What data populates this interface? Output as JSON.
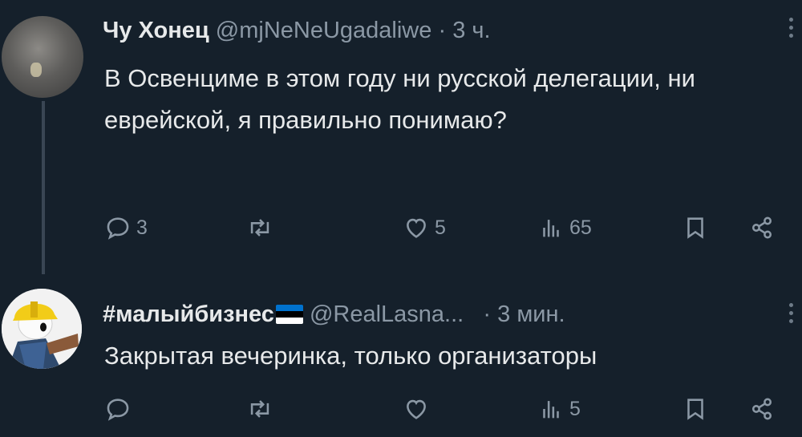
{
  "tweets": [
    {
      "name": "Чу Хонец",
      "handle": "@mjNeNeUgadaliwe",
      "separator": "·",
      "time": "3 ч.",
      "text": "В Освенциме в этом году ни русской делегации, ни еврейской, я правильно понимаю?",
      "stats": {
        "replies": "3",
        "reposts": "",
        "likes": "5",
        "views": "65"
      }
    },
    {
      "name": "#малыйбизнес",
      "name_flag_colors": [
        "#0072ce",
        "#000000",
        "#ffffff"
      ],
      "handle": "@RealLasna...",
      "separator": "·",
      "time": "3 мин.",
      "text": "Закрытая вечеринка, только организаторы",
      "stats": {
        "replies": "",
        "reposts": "",
        "likes": "",
        "views": "5"
      }
    }
  ],
  "icons": [
    "reply-icon",
    "repost-icon",
    "like-icon",
    "views-icon",
    "bookmark-icon",
    "share-icon",
    "more-options-icon"
  ],
  "theme": {
    "background": "#15202b",
    "text": "#e7e9ea",
    "secondary": "#8b98a5"
  }
}
